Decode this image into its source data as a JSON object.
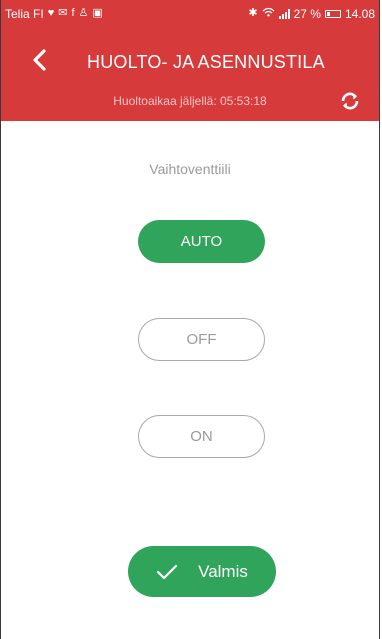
{
  "status_bar": {
    "carrier": "Telia FI",
    "notification_icons": [
      "heart-icon",
      "mail-icon",
      "facebook-icon",
      "person-icon",
      "image-icon"
    ],
    "battery_percent": "27 %",
    "battery_level": 0.27,
    "time": "14.08"
  },
  "header": {
    "title": "HUOLTO- JA ASENNUSTILA",
    "subtitle": "Huoltoaikaa jäljellä: 05:53:18"
  },
  "content": {
    "section_label": "Vaihtoventtiili",
    "options": [
      {
        "label": "AUTO",
        "selected": true
      },
      {
        "label": "OFF",
        "selected": false
      },
      {
        "label": "ON",
        "selected": false
      }
    ],
    "done_label": "Valmis"
  },
  "colors": {
    "header_red": "#d63a3a",
    "accent_green": "#2fa45a",
    "muted_gray": "#9a9a9a"
  }
}
